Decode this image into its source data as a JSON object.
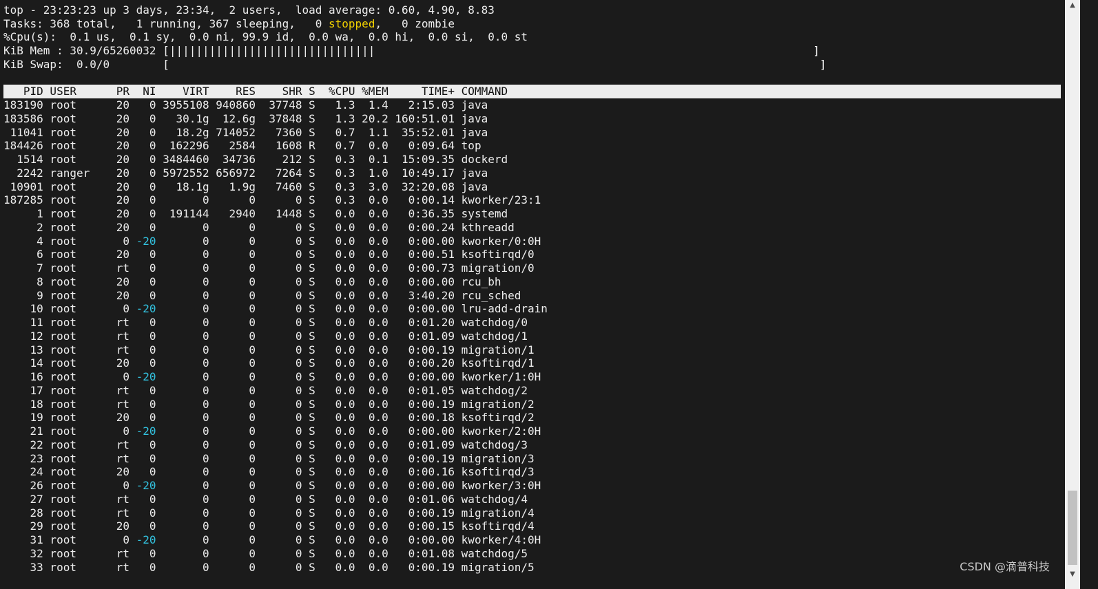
{
  "summary": {
    "line1": "top - 23:23:23 up 3 days, 23:34,  2 users,  load average: 0.60, 4.90, 8.83",
    "tasks_prefix": "Tasks: 368 total,   1 running, 367 sleeping,   0 ",
    "tasks_stopped": "stopped",
    "tasks_suffix": ",   0 zombie",
    "cpu": "%Cpu(s):  0.1 us,  0.1 sy,  0.0 ni, 99.9 id,  0.0 wa,  0.0 hi,  0.0 si,  0.0 st",
    "mem": "KiB Mem : 30.9/65260032 [|||||||||||||||||||||||||||||||                                                                  ]",
    "swap": "KiB Swap:  0.0/0        [                                                                                                  ]"
  },
  "table": {
    "header": "   PID USER      PR  NI    VIRT    RES    SHR S  %CPU %MEM     TIME+ COMMAND",
    "rows": [
      {
        "pre": "183190 root      20   ",
        "ni": "0",
        "post": " 3955108 940860  37748 S   1.3  1.4   2:15.03 java"
      },
      {
        "pre": "183586 root      20   ",
        "ni": "0",
        "post": "   30.1g  12.6g  37848 S   1.3 20.2 160:51.01 java"
      },
      {
        "pre": " 11041 root      20   ",
        "ni": "0",
        "post": "   18.2g 714052   7360 S   0.7  1.1  35:52.01 java"
      },
      {
        "pre": "184426 root      20   ",
        "ni": "0",
        "post": "  162296   2584   1608 R   0.7  0.0   0:09.64 top"
      },
      {
        "pre": "  1514 root      20   ",
        "ni": "0",
        "post": " 3484460  34736    212 S   0.3  0.1  15:09.35 dockerd"
      },
      {
        "pre": "  2242 ranger    20   ",
        "ni": "0",
        "post": " 5972552 656972   7264 S   0.3  1.0  10:49.17 java"
      },
      {
        "pre": " 10901 root      20   ",
        "ni": "0",
        "post": "   18.1g   1.9g   7460 S   0.3  3.0  32:20.08 java"
      },
      {
        "pre": "187285 root      20   ",
        "ni": "0",
        "post": "       0      0      0 S   0.3  0.0   0:00.14 kworker/23:1"
      },
      {
        "pre": "     1 root      20   ",
        "ni": "0",
        "post": "  191144   2940   1448 S   0.0  0.0   0:36.35 systemd"
      },
      {
        "pre": "     2 root      20   ",
        "ni": "0",
        "post": "       0      0      0 S   0.0  0.0   0:00.24 kthreadd"
      },
      {
        "pre": "     4 root       0 ",
        "ni": "-20",
        "post": "       0      0      0 S   0.0  0.0   0:00.00 kworker/0:0H"
      },
      {
        "pre": "     6 root      20   ",
        "ni": "0",
        "post": "       0      0      0 S   0.0  0.0   0:00.51 ksoftirqd/0"
      },
      {
        "pre": "     7 root      rt   ",
        "ni": "0",
        "post": "       0      0      0 S   0.0  0.0   0:00.73 migration/0"
      },
      {
        "pre": "     8 root      20   ",
        "ni": "0",
        "post": "       0      0      0 S   0.0  0.0   0:00.00 rcu_bh"
      },
      {
        "pre": "     9 root      20   ",
        "ni": "0",
        "post": "       0      0      0 S   0.0  0.0   3:40.20 rcu_sched"
      },
      {
        "pre": "    10 root       0 ",
        "ni": "-20",
        "post": "       0      0      0 S   0.0  0.0   0:00.00 lru-add-drain"
      },
      {
        "pre": "    11 root      rt   ",
        "ni": "0",
        "post": "       0      0      0 S   0.0  0.0   0:01.20 watchdog/0"
      },
      {
        "pre": "    12 root      rt   ",
        "ni": "0",
        "post": "       0      0      0 S   0.0  0.0   0:01.09 watchdog/1"
      },
      {
        "pre": "    13 root      rt   ",
        "ni": "0",
        "post": "       0      0      0 S   0.0  0.0   0:00.19 migration/1"
      },
      {
        "pre": "    14 root      20   ",
        "ni": "0",
        "post": "       0      0      0 S   0.0  0.0   0:00.20 ksoftirqd/1"
      },
      {
        "pre": "    16 root       0 ",
        "ni": "-20",
        "post": "       0      0      0 S   0.0  0.0   0:00.00 kworker/1:0H"
      },
      {
        "pre": "    17 root      rt   ",
        "ni": "0",
        "post": "       0      0      0 S   0.0  0.0   0:01.05 watchdog/2"
      },
      {
        "pre": "    18 root      rt   ",
        "ni": "0",
        "post": "       0      0      0 S   0.0  0.0   0:00.19 migration/2"
      },
      {
        "pre": "    19 root      20   ",
        "ni": "0",
        "post": "       0      0      0 S   0.0  0.0   0:00.18 ksoftirqd/2"
      },
      {
        "pre": "    21 root       0 ",
        "ni": "-20",
        "post": "       0      0      0 S   0.0  0.0   0:00.00 kworker/2:0H"
      },
      {
        "pre": "    22 root      rt   ",
        "ni": "0",
        "post": "       0      0      0 S   0.0  0.0   0:01.09 watchdog/3"
      },
      {
        "pre": "    23 root      rt   ",
        "ni": "0",
        "post": "       0      0      0 S   0.0  0.0   0:00.19 migration/3"
      },
      {
        "pre": "    24 root      20   ",
        "ni": "0",
        "post": "       0      0      0 S   0.0  0.0   0:00.16 ksoftirqd/3"
      },
      {
        "pre": "    26 root       0 ",
        "ni": "-20",
        "post": "       0      0      0 S   0.0  0.0   0:00.00 kworker/3:0H"
      },
      {
        "pre": "    27 root      rt   ",
        "ni": "0",
        "post": "       0      0      0 S   0.0  0.0   0:01.06 watchdog/4"
      },
      {
        "pre": "    28 root      rt   ",
        "ni": "0",
        "post": "       0      0      0 S   0.0  0.0   0:00.19 migration/4"
      },
      {
        "pre": "    29 root      20   ",
        "ni": "0",
        "post": "       0      0      0 S   0.0  0.0   0:00.15 ksoftirqd/4"
      },
      {
        "pre": "    31 root       0 ",
        "ni": "-20",
        "post": "       0      0      0 S   0.0  0.0   0:00.00 kworker/4:0H"
      },
      {
        "pre": "    32 root      rt   ",
        "ni": "0",
        "post": "       0      0      0 S   0.0  0.0   0:01.08 watchdog/5"
      },
      {
        "pre": "    33 root      rt   ",
        "ni": "0",
        "post": "       0      0      0 S   0.0  0.0   0:00.19 migration/5"
      }
    ]
  },
  "watermark": "CSDN @滴普科技",
  "scrollbar": {
    "up_icon": "chevron-up-icon",
    "down_icon": "chevron-down-icon"
  },
  "colors": {
    "background": "#1b1b1b",
    "text": "#ededed",
    "stopped": "#f0d000",
    "negative_nice": "#33c3e0"
  }
}
